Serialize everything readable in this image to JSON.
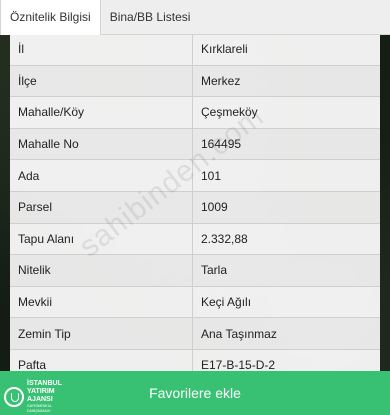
{
  "tabs": [
    {
      "label": "Öznitelik Bilgisi",
      "active": true
    },
    {
      "label": "Bina/BB Listesi",
      "active": false
    }
  ],
  "attributes": [
    {
      "key": "İl",
      "value": "Kırklareli"
    },
    {
      "key": "İlçe",
      "value": "Merkez"
    },
    {
      "key": "Mahalle/Köy",
      "value": "Çeşmeköy"
    },
    {
      "key": "Mahalle No",
      "value": "164495"
    },
    {
      "key": "Ada",
      "value": "101"
    },
    {
      "key": "Parsel",
      "value": "1009"
    },
    {
      "key": "Tapu Alanı",
      "value": "2.332,88"
    },
    {
      "key": "Nitelik",
      "value": "Tarla"
    },
    {
      "key": "Mevkii",
      "value": "Keçi Ağılı"
    },
    {
      "key": "Zemin Tip",
      "value": "Ana Taşınmaz"
    },
    {
      "key": "Pafta",
      "value": "E17-B-15-D-2"
    }
  ],
  "favorite_button": {
    "label": "Favorilere ekle"
  },
  "watermark": {
    "text": "sahibinden.com"
  },
  "logo": {
    "line1": "İSTANBUL",
    "line2": "YATIRIM",
    "line3": "AJANSI",
    "tagline": "GAYRİMENKUL DANIŞMANLIK"
  },
  "colors": {
    "accent_green": "#38c172",
    "tab_bar": "#eeeeee",
    "row_bg": "#ffffff",
    "map_bg": "#1a2318"
  }
}
